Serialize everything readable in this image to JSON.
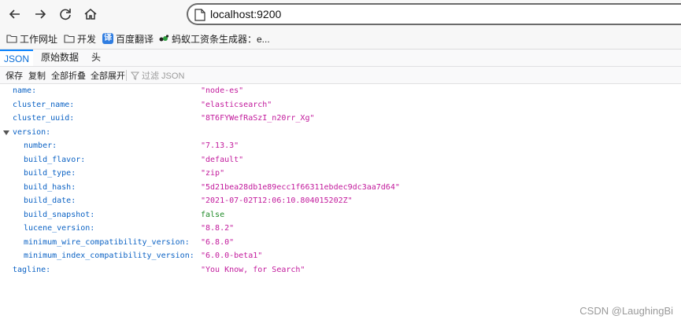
{
  "browser": {
    "url": "localhost:9200",
    "bookmarks": [
      {
        "label": "工作网址",
        "icon": "folder-icon"
      },
      {
        "label": "开发",
        "icon": "folder-icon"
      },
      {
        "label": "百度翻译",
        "icon": "translate-icon",
        "badge": "译"
      },
      {
        "label": "蚂蚁工资条生成器：e...",
        "icon": "ant-icon"
      }
    ]
  },
  "viewer": {
    "tabs": [
      "JSON",
      "原始数据",
      "头"
    ],
    "active_tab": "JSON",
    "actions": [
      "保存",
      "复制",
      "全部折叠",
      "全部展开"
    ],
    "filter_placeholder": "过滤 JSON"
  },
  "json": {
    "rows": [
      {
        "key": "name:",
        "value": "\"node-es\"",
        "type": "string"
      },
      {
        "key": "cluster_name:",
        "value": "\"elasticsearch\"",
        "type": "string"
      },
      {
        "key": "cluster_uuid:",
        "value": "\"8T6FYWefRaSzI_n20rr_Xg\"",
        "type": "string"
      },
      {
        "key": "version:",
        "value": "",
        "type": "object"
      },
      {
        "key": "number:",
        "value": "\"7.13.3\"",
        "type": "string"
      },
      {
        "key": "build_flavor:",
        "value": "\"default\"",
        "type": "string"
      },
      {
        "key": "build_type:",
        "value": "\"zip\"",
        "type": "string"
      },
      {
        "key": "build_hash:",
        "value": "\"5d21bea28db1e89ecc1f66311ebdec9dc3aa7d64\"",
        "type": "string"
      },
      {
        "key": "build_date:",
        "value": "\"2021-07-02T12:06:10.804015202Z\"",
        "type": "string"
      },
      {
        "key": "build_snapshot:",
        "value": "false",
        "type": "bool"
      },
      {
        "key": "lucene_version:",
        "value": "\"8.8.2\"",
        "type": "string"
      },
      {
        "key": "minimum_wire_compatibility_version:",
        "value": "\"6.8.0\"",
        "type": "string"
      },
      {
        "key": "minimum_index_compatibility_version:",
        "value": "\"6.0.0-beta1\"",
        "type": "string"
      },
      {
        "key": "tagline:",
        "value": "\"You Know, for Search\"",
        "type": "string"
      }
    ]
  },
  "watermark": "CSDN @LaughingBi",
  "colors": {
    "key": "#0b62c4",
    "string": "#c21a9c",
    "bool": "#1f8a27",
    "accent": "#0a84ff"
  }
}
